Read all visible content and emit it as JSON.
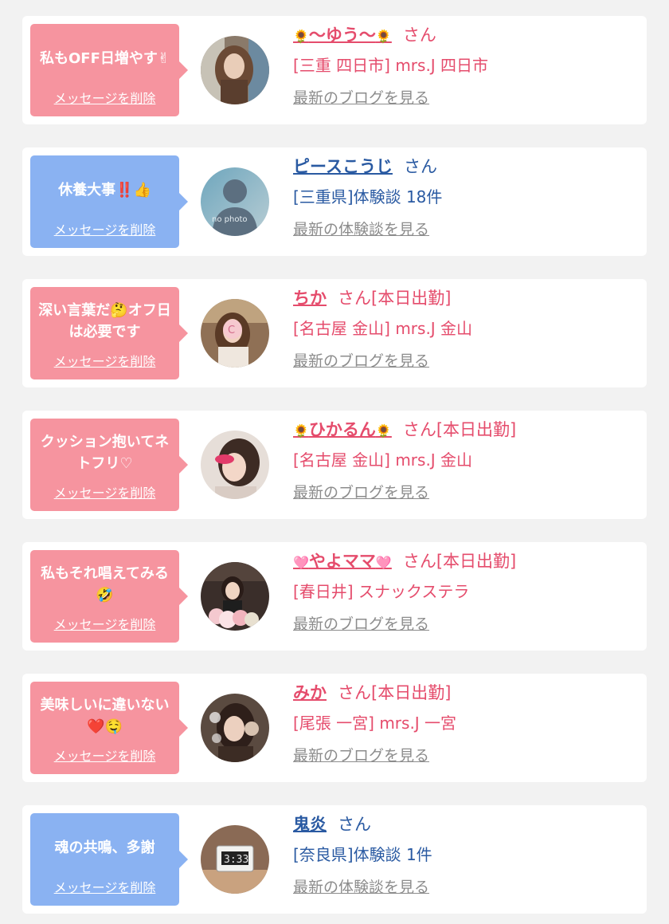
{
  "colors": {
    "pink": "#f6949f",
    "blue": "#8ab2f2",
    "pink_text": "#e54c6c",
    "blue_text": "#2a5aa2",
    "link_gray": "#8c8c8c"
  },
  "items": [
    {
      "type": "pink",
      "message": "私もOFF日増やす✌",
      "delete_label": "メッセージを削除",
      "name_prefix": "🌻",
      "name": "～ゆう～",
      "name_suffix_emoji": "🌻",
      "suffix": "さん",
      "sub": "[三重 四日市] mrs.J 四日市",
      "link": "最新のブログを見る",
      "avatar_icon": "girl-photo-icon"
    },
    {
      "type": "blue",
      "message": "休養大事‼️👍",
      "delete_label": "メッセージを削除",
      "name_prefix": "",
      "name": "ピースこうじ",
      "name_suffix_emoji": "",
      "suffix": "さん",
      "sub": "[三重県]体験談 18件",
      "link": "最新の体験談を見る",
      "avatar_icon": "no-photo-icon",
      "avatar_text": "no photo"
    },
    {
      "type": "pink",
      "message": "深い言葉だ🤔オフ日は必要です",
      "delete_label": "メッセージを削除",
      "name_prefix": "",
      "name": "ちか",
      "name_suffix_emoji": "",
      "suffix": "さん[本日出勤]",
      "sub": "[名古屋 金山] mrs.J 金山",
      "link": "最新のブログを見る",
      "avatar_icon": "girl-photo-icon"
    },
    {
      "type": "pink",
      "message": "クッション抱いてネトフリ♡",
      "delete_label": "メッセージを削除",
      "name_prefix": "🌻",
      "name": "ひかるん",
      "name_suffix_emoji": "🌻",
      "suffix": "さん[本日出勤]",
      "sub": "[名古屋 金山] mrs.J 金山",
      "link": "最新のブログを見る",
      "avatar_icon": "girl-photo-icon"
    },
    {
      "type": "pink",
      "message": "私もそれ唱えてみる🤣",
      "delete_label": "メッセージを削除",
      "name_prefix": "🩷",
      "name": "やよママ",
      "name_suffix_emoji": "🩷",
      "suffix": "さん[本日出勤]",
      "sub": "[春日井] スナックステラ",
      "link": "最新のブログを見る",
      "avatar_icon": "girl-photo-icon"
    },
    {
      "type": "pink",
      "message": "美味しいに違いない❤️🤤",
      "delete_label": "メッセージを削除",
      "name_prefix": "",
      "name": "みか",
      "name_suffix_emoji": "",
      "suffix": "さん[本日出勤]",
      "sub": "[尾張 一宮] mrs.J 一宮",
      "link": "最新のブログを見る",
      "avatar_icon": "girl-photo-icon"
    },
    {
      "type": "blue",
      "message": "魂の共鳴、多謝",
      "delete_label": "メッセージを削除",
      "name_prefix": "",
      "name": "鬼炎",
      "name_suffix_emoji": "",
      "suffix": "さん",
      "sub": "[奈良県]体験談 1件",
      "link": "最新の体験談を見る",
      "avatar_icon": "clock-photo-icon",
      "avatar_text": "3:33"
    }
  ]
}
